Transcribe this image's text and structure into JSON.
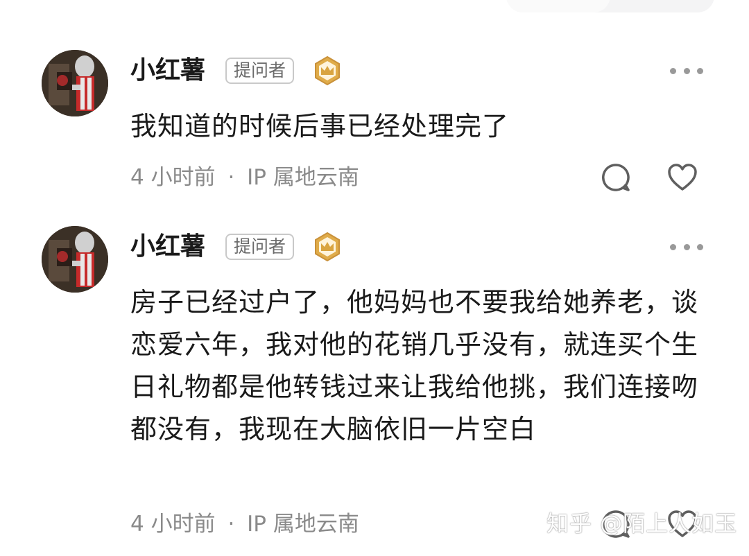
{
  "comments": [
    {
      "username": "小红薯",
      "role_badge": "提问者",
      "badge_icon": "crown-badge-icon",
      "text": "我知道的时候后事已经处理完了",
      "time": "4 小时前",
      "location": "IP 属地云南",
      "separator": "·"
    },
    {
      "username": "小红薯",
      "role_badge": "提问者",
      "badge_icon": "crown-badge-icon",
      "text": "房子已经过户了，他妈妈也不要我给她养老，谈恋爱六年，我对他的花销几乎没有，就连买个生日礼物都是他转钱过来让我给他挑，我们连接吻都没有，我现在大脑依旧一片空白",
      "time": "4 小时前",
      "location": "IP 属地云南",
      "separator": "·"
    }
  ],
  "watermark": "知乎 @陌上人如玉",
  "colors": {
    "text_primary": "#1a1a1a",
    "text_secondary": "#8a8a8a",
    "badge_gold": "#d9a441",
    "icon_gray": "#999999"
  }
}
